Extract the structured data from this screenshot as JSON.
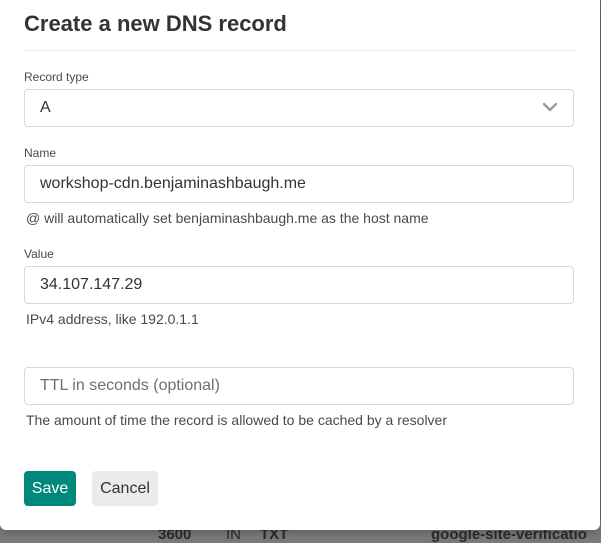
{
  "modal": {
    "title": "Create a new DNS record",
    "record_type": {
      "label": "Record type",
      "selected": "A"
    },
    "name": {
      "label": "Name",
      "value": "workshop-cdn.benjaminashbaugh.me",
      "help": "@ will automatically set benjaminashbaugh.me as the host name"
    },
    "value": {
      "label": "Value",
      "value": "34.107.147.29",
      "help": "IPv4 address, like 192.0.1.1"
    },
    "ttl": {
      "placeholder": "TTL in seconds (optional)",
      "help": "The amount of time the record is allowed to be cached by a resolver"
    },
    "buttons": {
      "save": "Save",
      "cancel": "Cancel"
    }
  },
  "background_row": {
    "ttl": "3600",
    "class": "IN",
    "type": "TXT",
    "value": "google-site-verificatio"
  },
  "colors": {
    "accent": "#00897b",
    "title_text": "#333333",
    "border": "#d8d8d8"
  },
  "icons": {
    "select_chevron": "chevron-down-icon"
  }
}
